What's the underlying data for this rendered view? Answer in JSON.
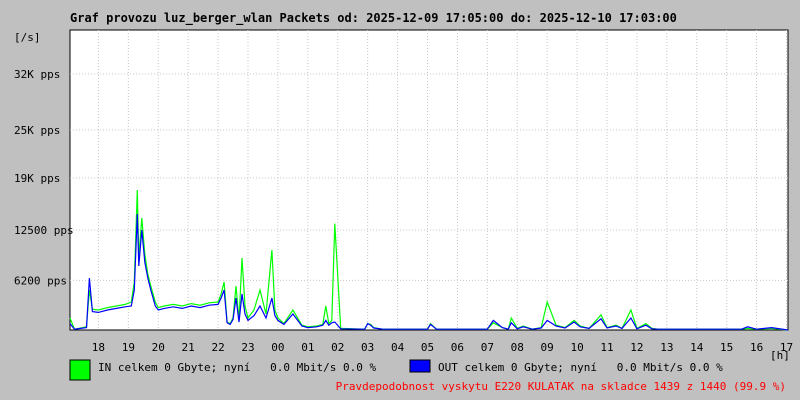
{
  "chart_data": {
    "type": "line",
    "title": "Graf provozu luz_berger_wlan Packets od: 2025-12-09 17:05:00 do: 2025-12-10 17:03:00",
    "ylabel": "[/s]",
    "xlabel": "[h]",
    "x_ticks": [
      "18",
      "19",
      "20",
      "21",
      "22",
      "23",
      "00",
      "01",
      "02",
      "03",
      "04",
      "05",
      "06",
      "07",
      "08",
      "09",
      "10",
      "11",
      "12",
      "13",
      "14",
      "15",
      "16",
      "17"
    ],
    "y_ticks": [
      {
        "label": "6200 pps",
        "value": 6200
      },
      {
        "label": "12500 pps",
        "value": 12500
      },
      {
        "label": "19K pps",
        "value": 19000
      },
      {
        "label": "25K pps",
        "value": 25000
      },
      {
        "label": "32K pps",
        "value": 32000
      }
    ],
    "xlim": [
      17.05,
      41.05
    ],
    "ylim": [
      0,
      37500
    ],
    "grid": true,
    "series": [
      {
        "name": "IN",
        "color": "#00ff00",
        "x": [
          17.05,
          17.2,
          17.6,
          17.7,
          17.8,
          18.0,
          18.3,
          18.6,
          18.9,
          19.1,
          19.2,
          19.3,
          19.35,
          19.45,
          19.55,
          19.65,
          19.75,
          19.9,
          20.0,
          20.2,
          20.5,
          20.8,
          21.1,
          21.4,
          21.7,
          22.0,
          22.1,
          22.2,
          22.3,
          22.4,
          22.5,
          22.6,
          22.7,
          22.8,
          22.9,
          23.0,
          23.2,
          23.4,
          23.6,
          23.8,
          23.9,
          24.0,
          24.2,
          24.5,
          24.8,
          25.0,
          25.3,
          25.5,
          25.6,
          25.7,
          25.8,
          25.9,
          26.1,
          26.9,
          27.0,
          27.1,
          27.2,
          27.5,
          29.0,
          29.1,
          29.3,
          31.0,
          31.2,
          31.5,
          31.7,
          31.8,
          32.0,
          32.2,
          32.5,
          32.8,
          33.0,
          33.3,
          33.6,
          33.9,
          34.1,
          34.4,
          34.8,
          35.0,
          35.3,
          35.5,
          35.8,
          36.0,
          36.3,
          36.5,
          36.7,
          37.0,
          39.0,
          39.5,
          39.7,
          40.0,
          40.5,
          41.05
        ],
        "y": [
          1500,
          100,
          400,
          5000,
          2600,
          2500,
          2800,
          3000,
          3200,
          3500,
          6000,
          17500,
          9000,
          14000,
          9500,
          7000,
          5500,
          3500,
          2800,
          3000,
          3200,
          3000,
          3300,
          3100,
          3400,
          3500,
          4500,
          6000,
          1000,
          800,
          1500,
          5500,
          1200,
          9000,
          3000,
          1500,
          2500,
          5000,
          2000,
          10000,
          2500,
          1500,
          800,
          2500,
          600,
          400,
          500,
          700,
          3000,
          800,
          1200,
          13300,
          200,
          100,
          800,
          700,
          300,
          100,
          100,
          800,
          100,
          100,
          900,
          300,
          100,
          1500,
          200,
          500,
          100,
          300,
          3500,
          600,
          300,
          1200,
          500,
          200,
          1900,
          300,
          600,
          200,
          2500,
          200,
          800,
          200,
          100,
          100,
          100,
          100,
          200,
          100,
          200,
          0
        ]
      },
      {
        "name": "OUT",
        "color": "#0000ff",
        "x": [
          17.05,
          17.2,
          17.6,
          17.7,
          17.8,
          18.0,
          18.3,
          18.6,
          18.9,
          19.1,
          19.2,
          19.3,
          19.35,
          19.45,
          19.55,
          19.65,
          19.75,
          19.9,
          20.0,
          20.2,
          20.5,
          20.8,
          21.1,
          21.4,
          21.7,
          22.0,
          22.1,
          22.2,
          22.3,
          22.4,
          22.5,
          22.6,
          22.7,
          22.8,
          22.9,
          23.0,
          23.2,
          23.4,
          23.6,
          23.8,
          23.9,
          24.0,
          24.2,
          24.5,
          24.8,
          25.0,
          25.3,
          25.5,
          25.6,
          25.7,
          25.8,
          25.9,
          26.1,
          26.9,
          27.0,
          27.1,
          27.2,
          27.5,
          29.0,
          29.1,
          29.3,
          31.0,
          31.2,
          31.5,
          31.7,
          31.8,
          32.0,
          32.2,
          32.5,
          32.8,
          33.0,
          33.3,
          33.6,
          33.9,
          34.1,
          34.4,
          34.8,
          35.0,
          35.3,
          35.5,
          35.8,
          36.0,
          36.3,
          36.5,
          36.7,
          37.0,
          39.0,
          39.5,
          39.7,
          40.0,
          40.5,
          41.05
        ],
        "y": [
          800,
          100,
          300,
          6500,
          2300,
          2200,
          2500,
          2700,
          2900,
          3000,
          5000,
          14500,
          8000,
          12500,
          8500,
          6500,
          5000,
          3000,
          2500,
          2700,
          2900,
          2700,
          3000,
          2800,
          3100,
          3200,
          4000,
          5000,
          900,
          700,
          1300,
          4000,
          1000,
          4500,
          2000,
          1200,
          1800,
          3000,
          1500,
          4000,
          1800,
          1200,
          700,
          2000,
          500,
          300,
          400,
          600,
          1200,
          600,
          900,
          1000,
          150,
          100,
          800,
          600,
          250,
          100,
          100,
          700,
          100,
          100,
          1200,
          300,
          100,
          900,
          150,
          400,
          100,
          250,
          1200,
          500,
          250,
          1000,
          400,
          200,
          1400,
          250,
          500,
          200,
          1500,
          150,
          600,
          150,
          100,
          100,
          100,
          100,
          400,
          100,
          300,
          0
        ]
      }
    ]
  },
  "legend": {
    "in": {
      "text": "IN celkem 0 Gbyte; nyní   0.0 Mbit/s 0.0 %",
      "color": "#00ff00"
    },
    "out": {
      "text": "OUT celkem 0 Gbyte; nyní   0.0 Mbit/s 0.0 %",
      "color": "#0000ff"
    }
  },
  "warning": {
    "text": "Pravdepodobnost vyskytu E220 KULATAK na skladce 1439 z 1440 (99.9 %)",
    "color": "#ff0000"
  }
}
